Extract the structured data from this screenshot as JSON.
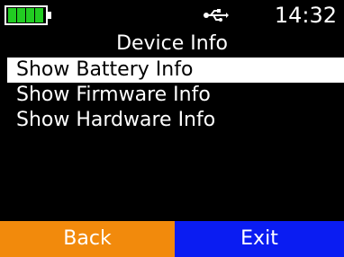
{
  "status": {
    "time": "14:32",
    "battery_level": 1.0,
    "battery_color": "#22cc22",
    "battery_icon": "battery-icon",
    "usb_icon": "usb-icon"
  },
  "screen": {
    "title": "Device Info"
  },
  "menu": {
    "selected_index": 0,
    "items": [
      {
        "label": "Show Battery Info"
      },
      {
        "label": "Show Firmware Info"
      },
      {
        "label": "Show Hardware Info"
      }
    ]
  },
  "softkeys": {
    "left": {
      "label": "Back",
      "color": "#f28a0c"
    },
    "right": {
      "label": "Exit",
      "color": "#0a1cf2"
    }
  }
}
